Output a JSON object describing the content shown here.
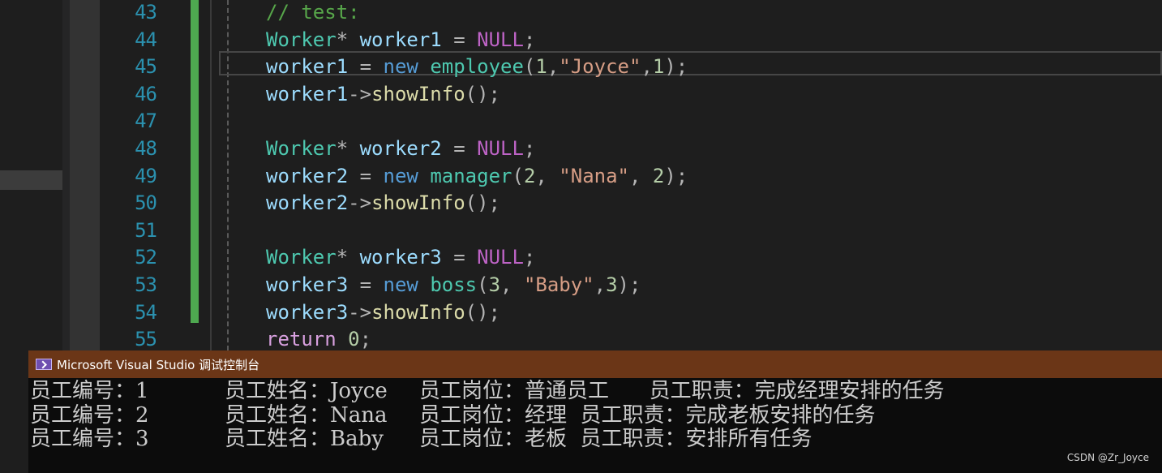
{
  "editor": {
    "lines": [
      {
        "number": "43",
        "tokens": [
          {
            "t": "// test:",
            "c": "comment"
          }
        ]
      },
      {
        "number": "44",
        "tokens": [
          {
            "t": "Worker",
            "c": "type"
          },
          {
            "t": "* ",
            "c": "plain"
          },
          {
            "t": "worker1",
            "c": "var"
          },
          {
            "t": " = ",
            "c": "plain"
          },
          {
            "t": "NULL",
            "c": "macro"
          },
          {
            "t": ";",
            "c": "plain"
          }
        ]
      },
      {
        "number": "45",
        "tokens": [
          {
            "t": "worker1",
            "c": "var"
          },
          {
            "t": " = ",
            "c": "plain"
          },
          {
            "t": "new",
            "c": "kw"
          },
          {
            "t": " ",
            "c": "plain"
          },
          {
            "t": "employee",
            "c": "class"
          },
          {
            "t": "(",
            "c": "plain"
          },
          {
            "t": "1",
            "c": "num"
          },
          {
            "t": ",",
            "c": "plain"
          },
          {
            "t": "\"Joyce\"",
            "c": "str"
          },
          {
            "t": ",",
            "c": "plain"
          },
          {
            "t": "1",
            "c": "num"
          },
          {
            "t": ");",
            "c": "plain"
          }
        ]
      },
      {
        "number": "46",
        "tokens": [
          {
            "t": "worker1",
            "c": "var"
          },
          {
            "t": "->",
            "c": "plain"
          },
          {
            "t": "showInfo",
            "c": "func"
          },
          {
            "t": "();",
            "c": "plain"
          }
        ]
      },
      {
        "number": "47",
        "tokens": []
      },
      {
        "number": "48",
        "tokens": [
          {
            "t": "Worker",
            "c": "type"
          },
          {
            "t": "* ",
            "c": "plain"
          },
          {
            "t": "worker2",
            "c": "var"
          },
          {
            "t": " = ",
            "c": "plain"
          },
          {
            "t": "NULL",
            "c": "macro"
          },
          {
            "t": ";",
            "c": "plain"
          }
        ]
      },
      {
        "number": "49",
        "tokens": [
          {
            "t": "worker2",
            "c": "var"
          },
          {
            "t": " = ",
            "c": "plain"
          },
          {
            "t": "new",
            "c": "kw"
          },
          {
            "t": " ",
            "c": "plain"
          },
          {
            "t": "manager",
            "c": "class"
          },
          {
            "t": "(",
            "c": "plain"
          },
          {
            "t": "2",
            "c": "num"
          },
          {
            "t": ", ",
            "c": "plain"
          },
          {
            "t": "\"Nana\"",
            "c": "str"
          },
          {
            "t": ", ",
            "c": "plain"
          },
          {
            "t": "2",
            "c": "num"
          },
          {
            "t": ");",
            "c": "plain"
          }
        ]
      },
      {
        "number": "50",
        "tokens": [
          {
            "t": "worker2",
            "c": "var"
          },
          {
            "t": "->",
            "c": "plain"
          },
          {
            "t": "showInfo",
            "c": "func"
          },
          {
            "t": "();",
            "c": "plain"
          }
        ]
      },
      {
        "number": "51",
        "tokens": []
      },
      {
        "number": "52",
        "tokens": [
          {
            "t": "Worker",
            "c": "type"
          },
          {
            "t": "* ",
            "c": "plain"
          },
          {
            "t": "worker3",
            "c": "var"
          },
          {
            "t": " = ",
            "c": "plain"
          },
          {
            "t": "NULL",
            "c": "macro"
          },
          {
            "t": ";",
            "c": "plain"
          }
        ]
      },
      {
        "number": "53",
        "tokens": [
          {
            "t": "worker3",
            "c": "var"
          },
          {
            "t": " = ",
            "c": "plain"
          },
          {
            "t": "new",
            "c": "kw"
          },
          {
            "t": " ",
            "c": "plain"
          },
          {
            "t": "boss",
            "c": "class"
          },
          {
            "t": "(",
            "c": "plain"
          },
          {
            "t": "3",
            "c": "num"
          },
          {
            "t": ", ",
            "c": "plain"
          },
          {
            "t": "\"Baby\"",
            "c": "str"
          },
          {
            "t": ",",
            "c": "plain"
          },
          {
            "t": "3",
            "c": "num"
          },
          {
            "t": ");",
            "c": "plain"
          }
        ]
      },
      {
        "number": "54",
        "tokens": [
          {
            "t": "worker3",
            "c": "var"
          },
          {
            "t": "->",
            "c": "plain"
          },
          {
            "t": "showInfo",
            "c": "func"
          },
          {
            "t": "();",
            "c": "plain"
          }
        ]
      },
      {
        "number": "55",
        "tokens": [
          {
            "t": "return",
            "c": "kwctrl"
          },
          {
            "t": " ",
            "c": "plain"
          },
          {
            "t": "0",
            "c": "num"
          },
          {
            "t": ";",
            "c": "plain"
          }
        ]
      }
    ]
  },
  "console": {
    "title": "Microsoft Visual Studio 调试控制台",
    "icon": "console-app-icon",
    "title_bar_color": "#6b3617",
    "rows": [
      {
        "id": "员工编号：1",
        "name": "员工姓名：Joyce",
        "rest": "员工岗位：普通员工      员工职责：完成经理安排的任务"
      },
      {
        "id": "员工编号：2",
        "name": "员工姓名：Nana ",
        "rest": "员工岗位：经理  员工职责：完成老板安排的任务"
      },
      {
        "id": "员工编号：3",
        "name": "员工姓名：Baby ",
        "rest": "员工岗位：老板  员工职责：安排所有任务"
      }
    ],
    "watermark": "CSDN @Zr_Joyce"
  }
}
